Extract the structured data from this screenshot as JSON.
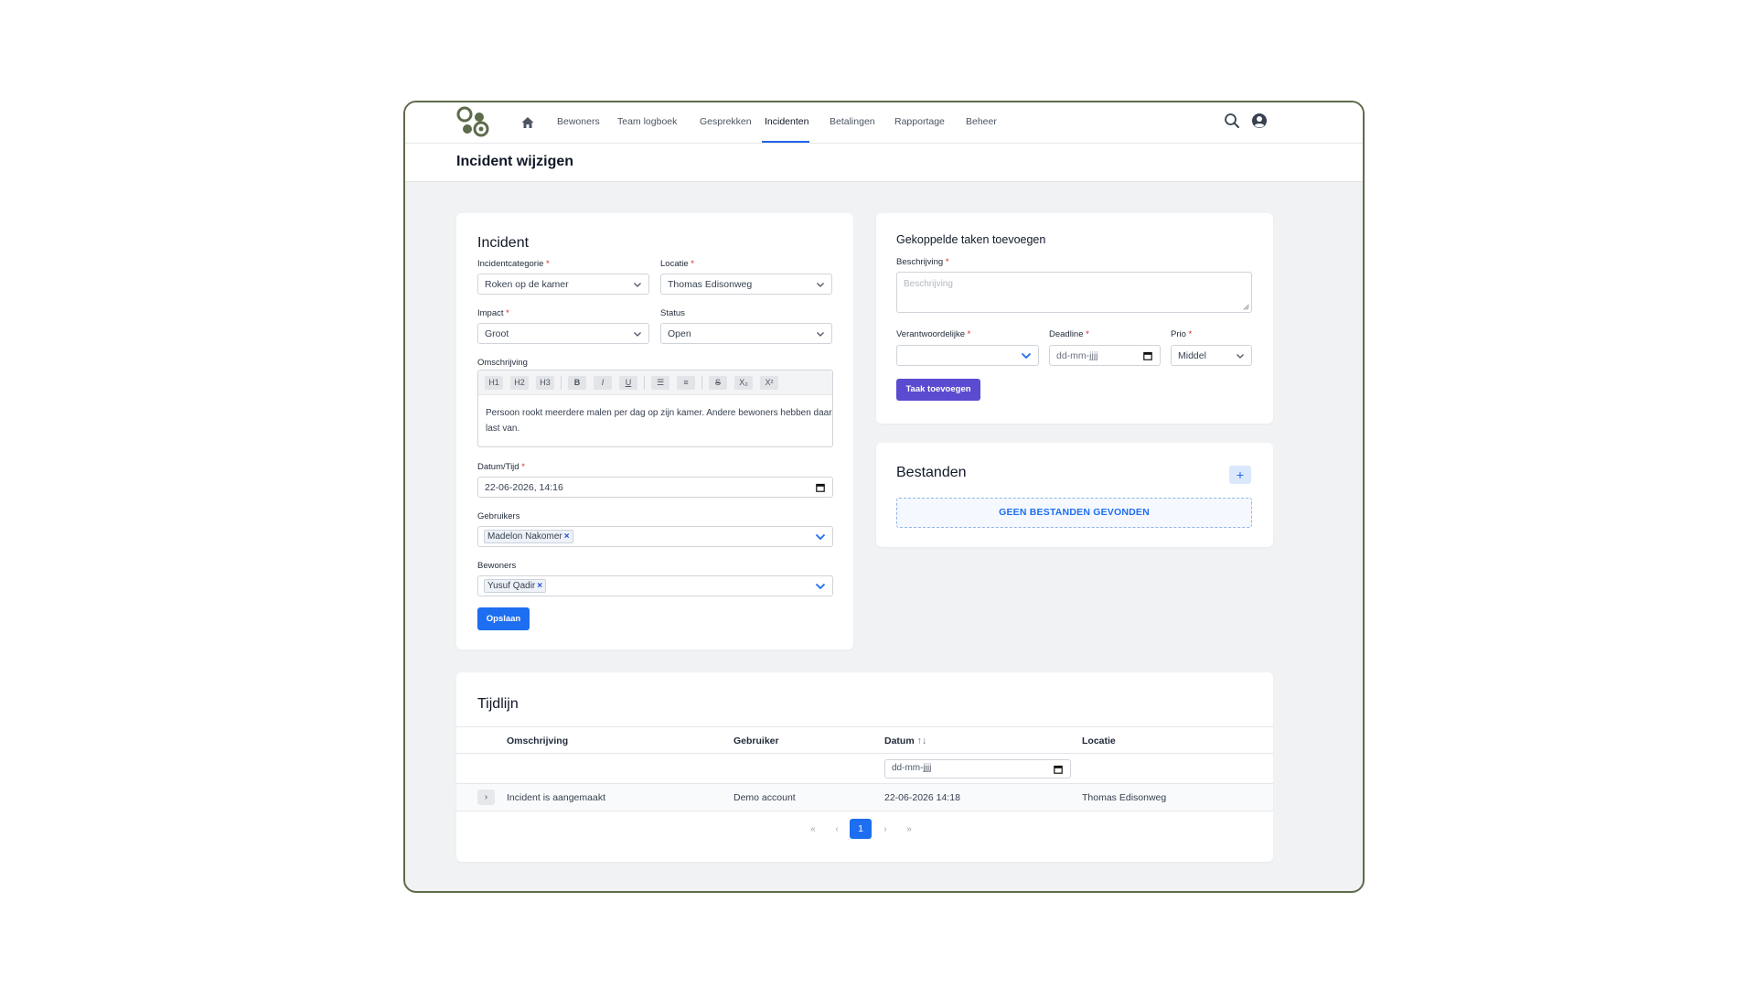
{
  "nav": {
    "items": [
      {
        "label": "Bewoners"
      },
      {
        "label": "Team logboek"
      },
      {
        "label": "Gesprekken"
      },
      {
        "label": "Incidenten"
      },
      {
        "label": "Betalingen"
      },
      {
        "label": "Rapportage"
      },
      {
        "label": "Beheer"
      }
    ],
    "active_index": 3
  },
  "page": {
    "title": "Incident wijzigen"
  },
  "incident_form": {
    "title": "Incident",
    "category": {
      "label": "Incidentcategorie",
      "required": "*",
      "value": "Roken op de kamer"
    },
    "location": {
      "label": "Locatie",
      "required": "*",
      "value": "Thomas Edisonweg"
    },
    "impact": {
      "label": "Impact",
      "required": "*",
      "value": "Groot"
    },
    "status": {
      "label": "Status",
      "value": "Open"
    },
    "description": {
      "label": "Omschrijving",
      "toolbar": [
        "H1",
        "H2",
        "H3",
        "B",
        "I",
        "U",
        "☰",
        "≡",
        "S",
        "X₂",
        "X²"
      ],
      "text": "Persoon rookt meerdere malen per dag op zijn kamer. Andere bewoners hebben daar last van."
    },
    "datetime": {
      "label": "Datum/Tijd",
      "required": "*",
      "value": "22-06-2026, 14:16"
    },
    "users": {
      "label": "Gebruikers",
      "chips": [
        "Madelon Nakomer"
      ]
    },
    "residents": {
      "label": "Bewoners",
      "chips": [
        "Yusuf Qadir"
      ]
    },
    "save_label": "Opslaan"
  },
  "tasks_card": {
    "title": "Gekoppelde taken toevoegen",
    "description": {
      "label": "Beschrijving",
      "required": "*",
      "placeholder": "Beschrijving"
    },
    "responsible": {
      "label": "Verantwoordelijke",
      "required": "*",
      "value": ""
    },
    "deadline": {
      "label": "Deadline",
      "required": "*",
      "placeholder": "dd-mm-jjjj"
    },
    "prio": {
      "label": "Prio",
      "required": "*",
      "value": "Middel"
    },
    "add_label": "Taak toevoegen"
  },
  "files_card": {
    "title": "Bestanden",
    "add_label": "+",
    "empty_text": "GEEN BESTANDEN GEVONDEN"
  },
  "timeline": {
    "title": "Tijdlijn",
    "columns": [
      "Omschrijving",
      "Gebruiker",
      "Datum",
      "Locatie"
    ],
    "date_sort_icon": "↑↓",
    "date_filter_placeholder": "dd-mm-jjjj",
    "rows": [
      {
        "description": "Incident is aangemaakt",
        "user": "Demo account",
        "date": "22-06-2026 14:18",
        "location": "Thomas Edisonweg"
      }
    ],
    "pagination": {
      "first": "«",
      "prev": "‹",
      "current": "1",
      "next": "›",
      "last": "»"
    }
  },
  "colors": {
    "primary": "#1d6ef0",
    "task_button": "#5a4bd1",
    "required": "#dc2626",
    "frame_border": "#5e6b4a",
    "logo": "#5e6b4a"
  }
}
